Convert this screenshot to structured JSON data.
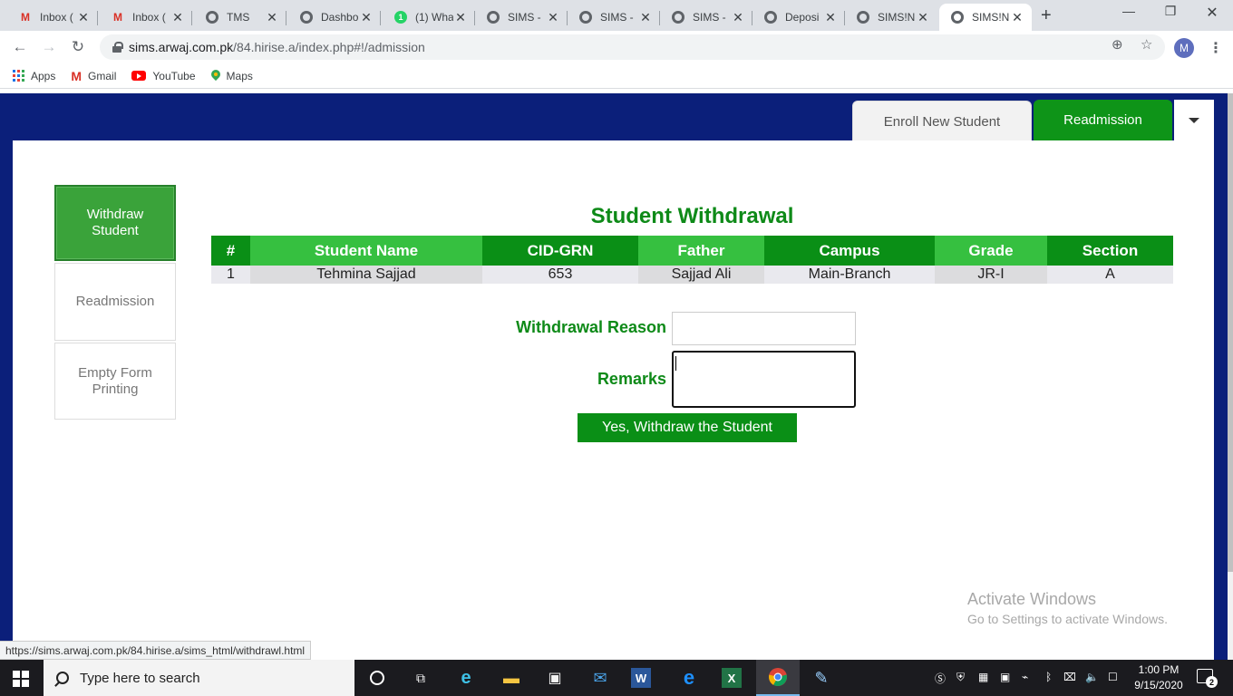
{
  "browser": {
    "tabs": [
      {
        "title": "Inbox (",
        "icon": "gmail-icon"
      },
      {
        "title": "Inbox (",
        "icon": "gmail-icon"
      },
      {
        "title": "TMS",
        "icon": "globe-icon"
      },
      {
        "title": "Dashbo",
        "icon": "globe-icon"
      },
      {
        "title": "(1) Wha",
        "icon": "whatsapp-icon",
        "badge": "1"
      },
      {
        "title": "SIMS -",
        "icon": "globe-icon"
      },
      {
        "title": "SIMS -",
        "icon": "globe-icon"
      },
      {
        "title": "SIMS -",
        "icon": "globe-icon"
      },
      {
        "title": "Deposi",
        "icon": "globe-icon"
      },
      {
        "title": "SIMS!N",
        "icon": "globe-icon"
      },
      {
        "title": "SIMS!N",
        "icon": "globe-icon",
        "active": true
      }
    ],
    "url_host": "sims.arwaj.com.pk",
    "url_path": "/84.hirise.a/index.php#!/admission",
    "profile_initial": "M",
    "bookmarks": [
      {
        "label": "Apps",
        "icon": "apps-grid-icon"
      },
      {
        "label": "Gmail",
        "icon": "gmail-icon"
      },
      {
        "label": "YouTube",
        "icon": "youtube-icon"
      },
      {
        "label": "Maps",
        "icon": "maps-pin-icon"
      }
    ],
    "status_url": "https://sims.arwaj.com.pk/84.hirise.a/sims_html/withdrawl.html"
  },
  "top_tabs": {
    "enroll": "Enroll New Student",
    "readmission": "Readmission"
  },
  "sidebar": {
    "items": [
      {
        "label": "Withdraw Student",
        "active": true
      },
      {
        "label": "Readmission",
        "active": false
      },
      {
        "label": "Empty Form Printing",
        "active": false
      }
    ]
  },
  "main": {
    "title": "Student Withdrawal",
    "table": {
      "headers": [
        "#",
        "Student Name",
        "CID-GRN",
        "Father",
        "Campus",
        "Grade",
        "Section"
      ],
      "rows": [
        [
          "1",
          "Tehmina Sajjad",
          "653",
          "Sajjad Ali",
          "Main-Branch",
          "JR-I",
          "A"
        ]
      ]
    },
    "form": {
      "reason_label": "Withdrawal Reason",
      "reason_value": "",
      "remarks_label": "Remarks",
      "remarks_value": "",
      "submit_label": "Yes, Withdraw the Student"
    }
  },
  "watermark": {
    "line1": "Activate Windows",
    "line2": "Go to Settings to activate Windows."
  },
  "taskbar": {
    "search_placeholder": "Type here to search",
    "time": "1:00 PM",
    "date": "9/15/2020",
    "notification_count": "2",
    "apps": [
      "cortana-icon",
      "task-view-icon",
      "edge-icon",
      "file-explorer-icon",
      "store-icon",
      "mail-icon",
      "word-icon",
      "ie-icon",
      "excel-icon",
      "chrome-icon",
      "paint-icon"
    ]
  },
  "colors": {
    "brand_green": "#0a8f16",
    "navy_bg": "#0b1f7a"
  }
}
